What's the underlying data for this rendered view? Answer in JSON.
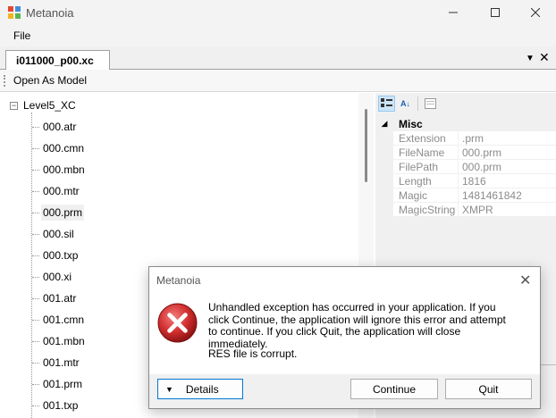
{
  "window": {
    "title": "Metanoia"
  },
  "menu": {
    "file": "File"
  },
  "tab": {
    "label": "i011000_p00.xc"
  },
  "toolbar": {
    "open_as_model": "Open As Model"
  },
  "tree": {
    "root": "Level5_XC",
    "items": [
      "000.atr",
      "000.cmn",
      "000.mbn",
      "000.mtr",
      "000.prm",
      "000.sil",
      "000.txp",
      "000.xi",
      "001.atr",
      "001.cmn",
      "001.mbn",
      "001.mtr",
      "001.prm",
      "001.txp"
    ],
    "selected": "000.prm"
  },
  "properties": {
    "category": "Misc",
    "rows": [
      {
        "name": "Extension",
        "value": ".prm"
      },
      {
        "name": "FileName",
        "value": "000.prm"
      },
      {
        "name": "FilePath",
        "value": "000.prm"
      },
      {
        "name": "Length",
        "value": "1816"
      },
      {
        "name": "Magic",
        "value": "1481461842"
      },
      {
        "name": "MagicString",
        "value": "XMPR"
      }
    ]
  },
  "dialog": {
    "title": "Metanoia",
    "message": "Unhandled exception has occurred in your application. If you click Continue, the application will ignore this error and attempt to continue. If you click Quit, the application will close immediately.",
    "detail": "RES file is corrupt.",
    "details_label": "Details",
    "continue_label": "Continue",
    "quit_label": "Quit"
  },
  "colors": {
    "accent": "#0078d7",
    "error_red": "#d12e2e"
  }
}
